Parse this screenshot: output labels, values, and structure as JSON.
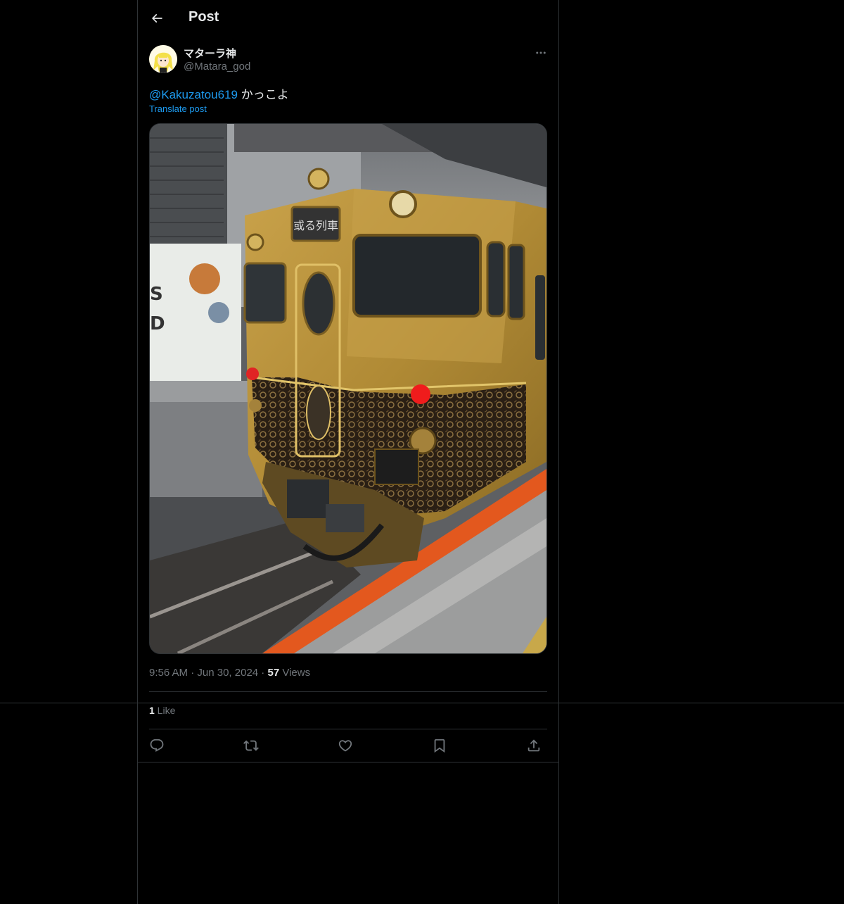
{
  "header": {
    "title": "Post",
    "back_icon": "arrow-left-icon"
  },
  "author": {
    "display_name": "マターラ神",
    "handle": "@Matara_god",
    "avatar_icon": "avatar"
  },
  "tweet": {
    "mention": "@Kakuzatou619",
    "text": " かっこよ",
    "translate_label": "Translate post",
    "media_alt": "gold train photo"
  },
  "meta": {
    "time": "9:56 AM",
    "sep1": " · ",
    "date": "Jun 30, 2024",
    "sep2": " · ",
    "views_count": "57",
    "views_label": " Views"
  },
  "stats": {
    "likes_count": "1",
    "likes_label": " Like"
  },
  "actions": {
    "reply_icon": "reply-icon",
    "repost_icon": "repost-icon",
    "like_icon": "heart-icon",
    "bookmark_icon": "bookmark-icon",
    "share_icon": "share-icon"
  },
  "colors": {
    "background": "#000000",
    "accent": "#1d9bf0",
    "text": "#e7e9ea",
    "muted": "#71767b",
    "border": "#2f3336"
  }
}
